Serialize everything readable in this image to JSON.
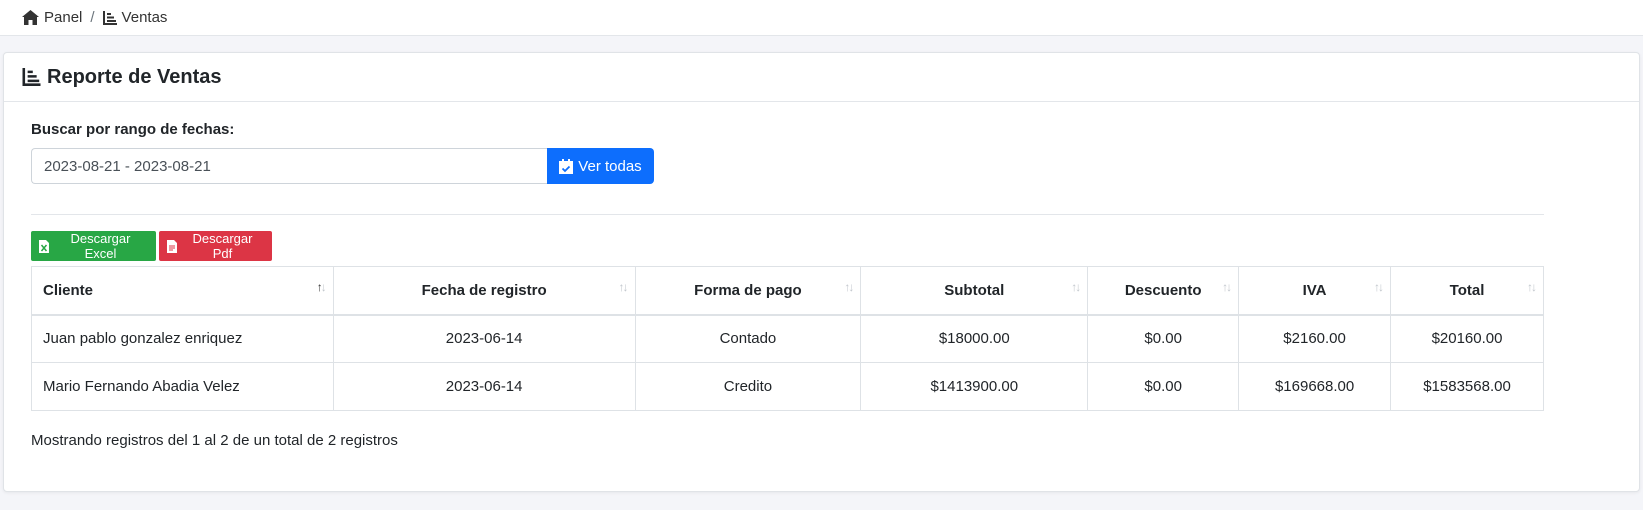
{
  "breadcrumb": {
    "home": "Panel",
    "separator": "/",
    "current": "Ventas"
  },
  "card": {
    "title": "Reporte de Ventas"
  },
  "filter": {
    "label": "Buscar por rango de fechas:",
    "value": "2023-08-21 - 2023-08-21",
    "button": "Ver todas"
  },
  "export": {
    "excel": "Descargar Excel",
    "pdf": "Descargar Pdf"
  },
  "table": {
    "columns": [
      "Cliente",
      "Fecha de registro",
      "Forma de pago",
      "Subtotal",
      "Descuento",
      "IVA",
      "Total"
    ],
    "rows": [
      [
        "Juan pablo gonzalez enriquez",
        "2023-06-14",
        "Contado",
        "$18000.00",
        "$0.00",
        "$2160.00",
        "$20160.00"
      ],
      [
        "Mario Fernando Abadia Velez",
        "2023-06-14",
        "Credito",
        "$1413900.00",
        "$0.00",
        "$169668.00",
        "$1583568.00"
      ]
    ]
  },
  "info": "Mostrando registros del 1 al 2 de un total de 2 registros",
  "colors": {
    "primary": "#0d6efd",
    "success": "#28a745",
    "danger": "#dc3545"
  },
  "icons": {
    "home": "home-icon",
    "chart": "chart-icon",
    "calendar": "calendar-check-icon",
    "excel": "file-excel-icon",
    "pdf": "file-pdf-icon"
  }
}
